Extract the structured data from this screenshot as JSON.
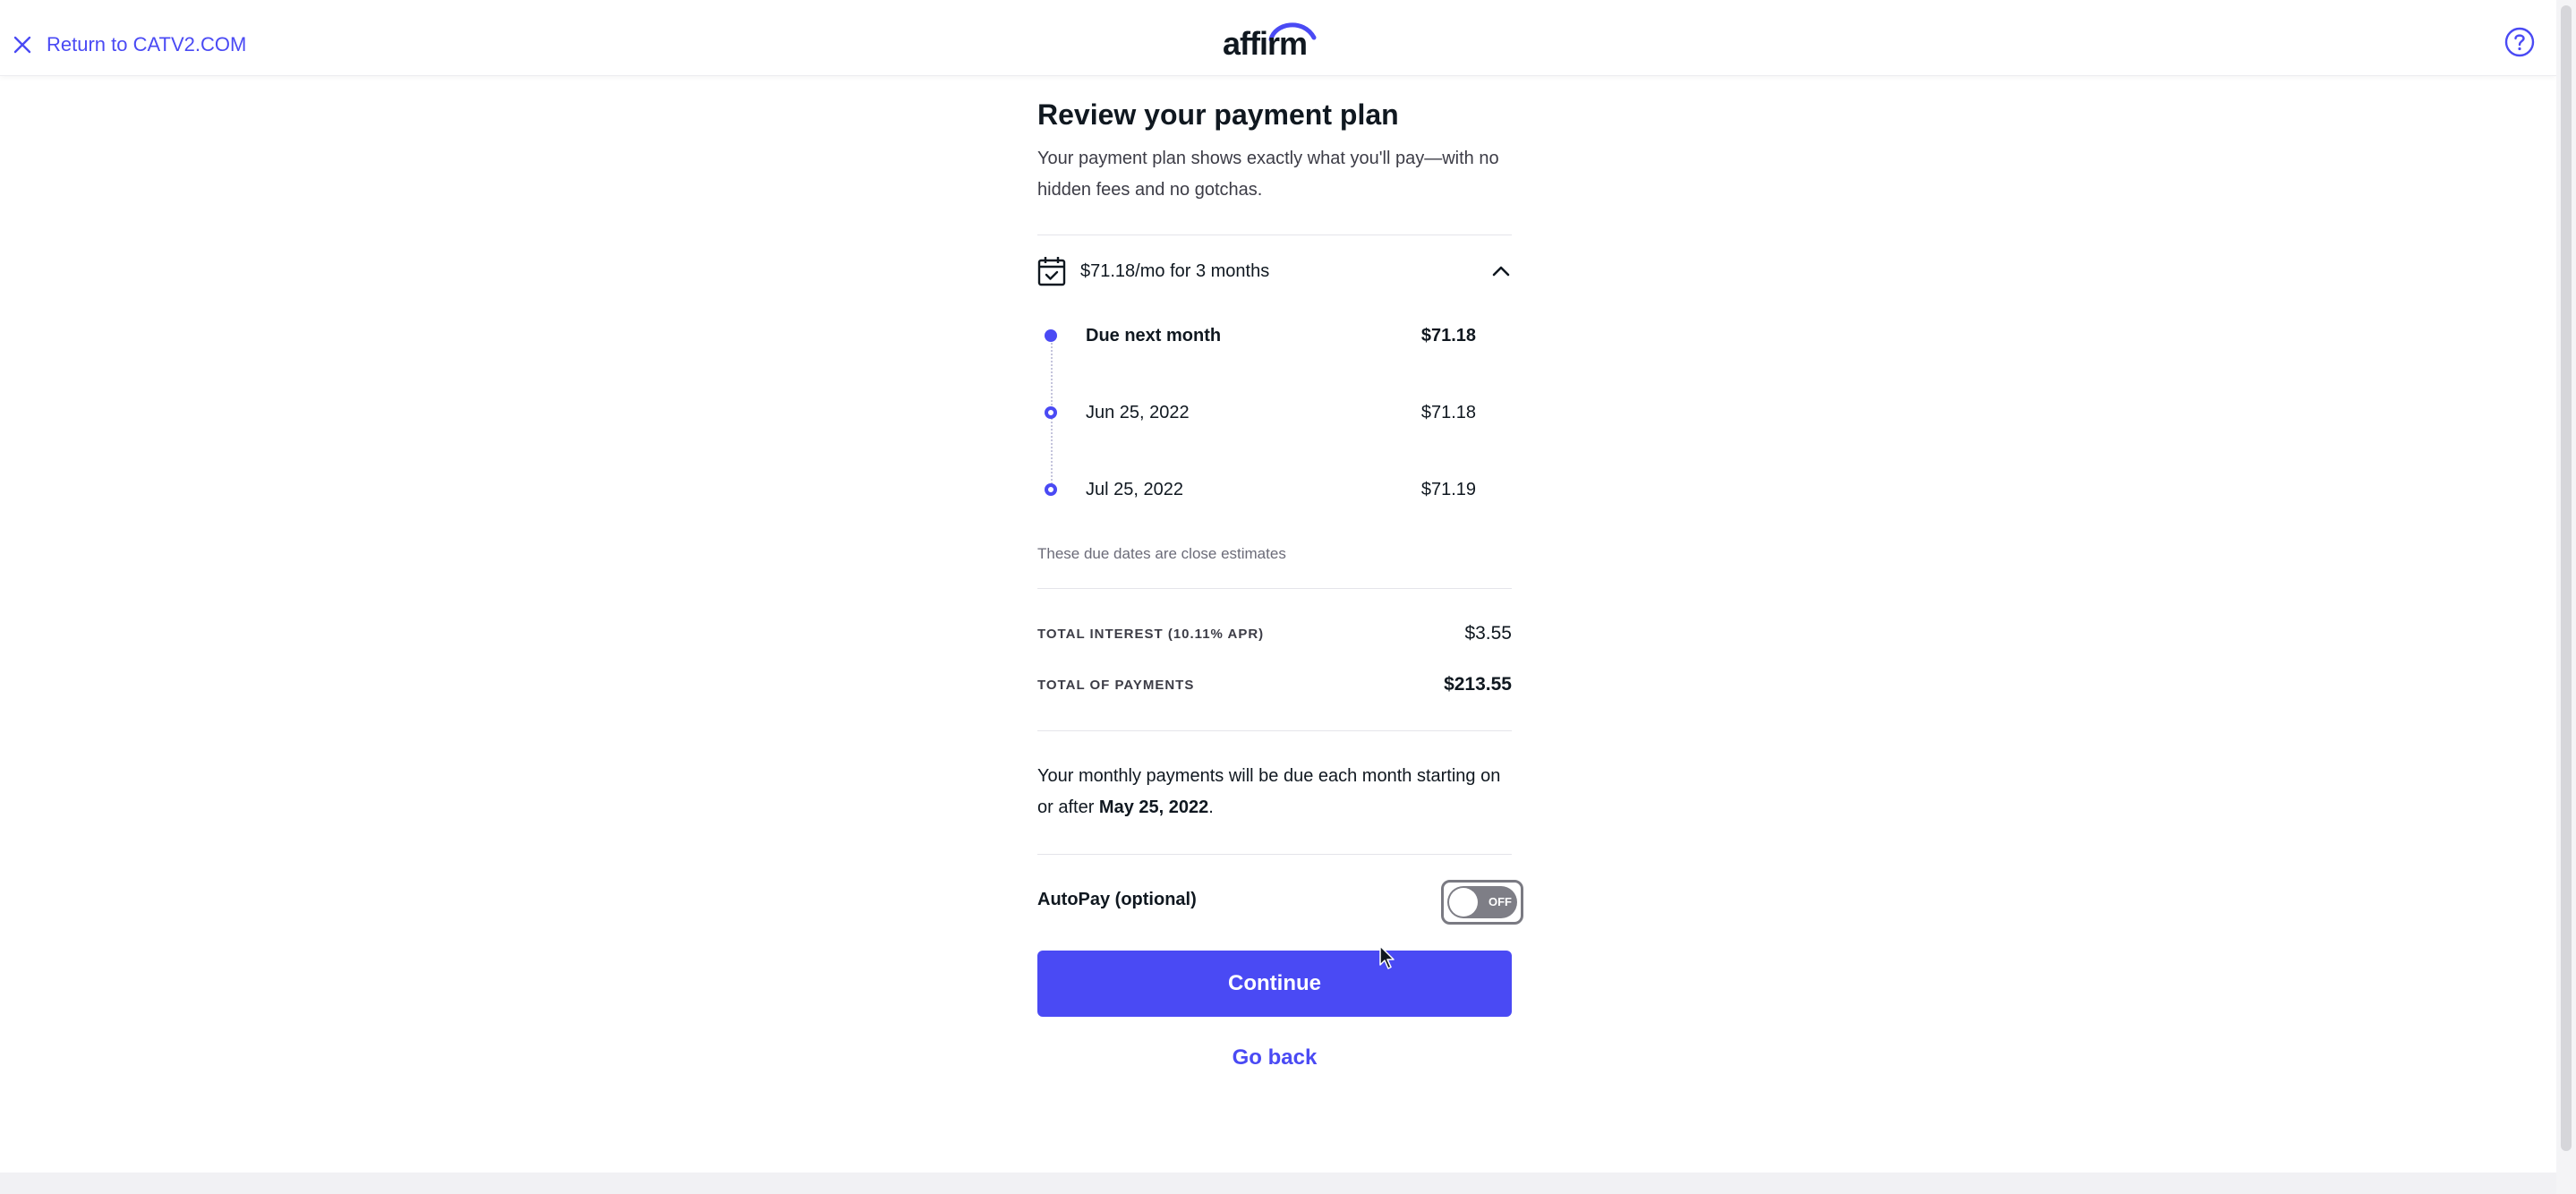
{
  "header": {
    "return_label": "Return to CATV2.COM",
    "logo_text": "affirm"
  },
  "plan": {
    "title": "Review your payment plan",
    "subtitle": "Your payment plan shows exactly what you'll pay—with no hidden fees and no gotchas.",
    "summary": "$71.18/mo for 3 months",
    "schedule": [
      {
        "label": "Due next month",
        "amount": "$71.18"
      },
      {
        "label": "Jun 25, 2022",
        "amount": "$71.18"
      },
      {
        "label": "Jul 25, 2022",
        "amount": "$71.19"
      }
    ],
    "note": "These due dates are close estimates"
  },
  "totals": {
    "interest_label": "TOTAL INTEREST (10.11% APR)",
    "interest_value": "$3.55",
    "payments_label": "TOTAL OF PAYMENTS",
    "payments_value": "$213.55"
  },
  "info": {
    "text": "Your monthly payments will be due each month starting on or after ",
    "date": "May 25, 2022",
    "end": "."
  },
  "autopay": {
    "label": "AutoPay (optional)",
    "toggle_text": "OFF",
    "enabled": false
  },
  "actions": {
    "continue_label": "Continue",
    "goback_label": "Go back"
  },
  "colors": {
    "accent": "#4a4af4",
    "text": "#101820"
  },
  "icons": {
    "close": "close-icon",
    "help": "help-icon",
    "calendar": "calendar-check-icon",
    "chevron": "chevron-up-icon"
  }
}
